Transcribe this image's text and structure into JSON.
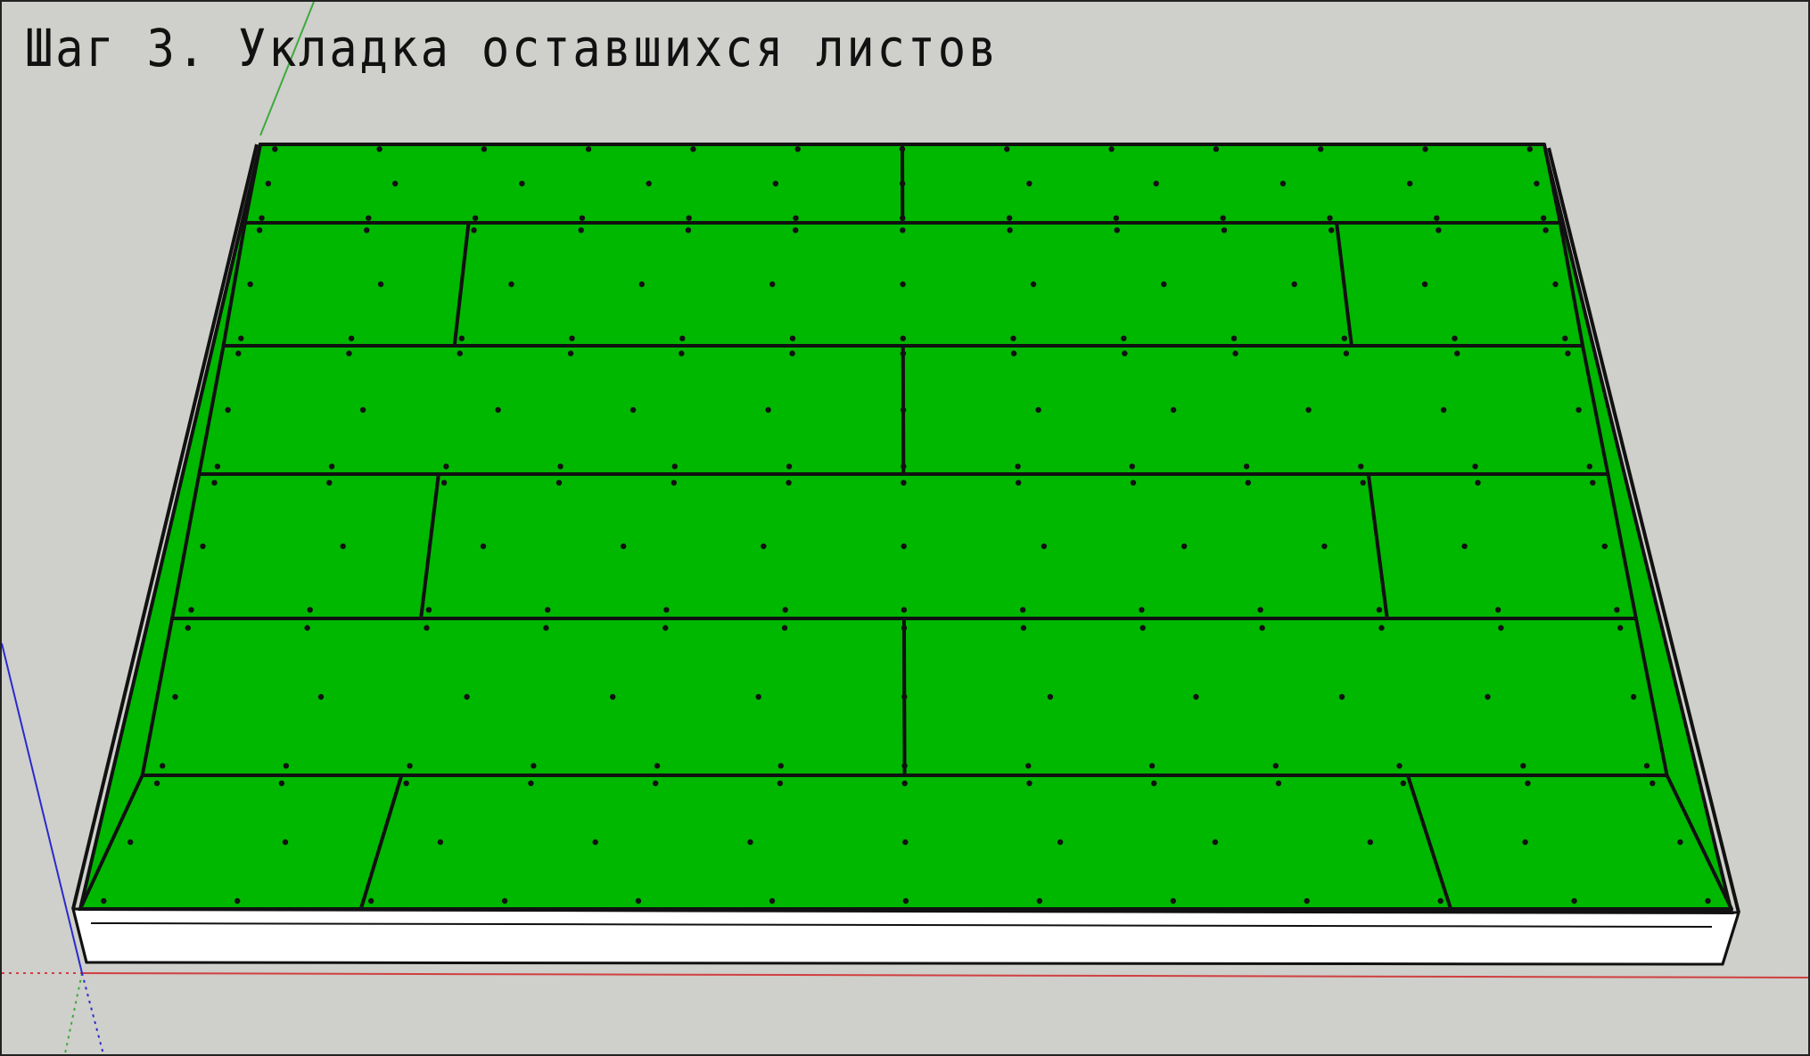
{
  "title": "Шаг 3. Укладка оставшихся листов",
  "colors": {
    "background": "#cfcfcb",
    "sheet_fill": "#00b800",
    "seam": "#111111",
    "base_board": "#ffffff",
    "axis_red": "#d04040",
    "axis_green": "#3cab3c",
    "axis_blue": "#2a2acc"
  },
  "layout": {
    "rows_of_sheets": 6,
    "full_rows": [
      0,
      2,
      4
    ],
    "offset_rows": [
      1,
      3,
      5
    ]
  }
}
